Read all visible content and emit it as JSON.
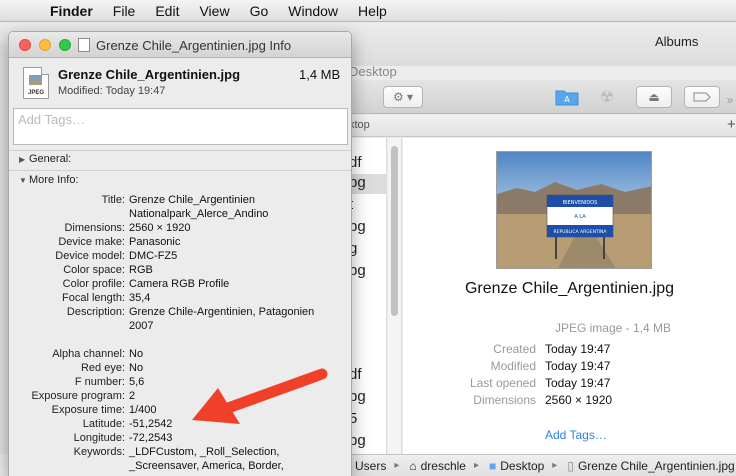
{
  "menubar": {
    "apple": "",
    "items": [
      "Finder",
      "File",
      "Edit",
      "View",
      "Go",
      "Window",
      "Help"
    ]
  },
  "finder": {
    "right_title": "Albums",
    "window_title": "Desktop",
    "path_header": "ktop",
    "list_fragments": [
      "df",
      "pg",
      "t",
      "pg",
      "g",
      "pg",
      "df",
      "pg",
      "5",
      "pg"
    ],
    "preview": {
      "file_name": "Grenze Chile_Argentinien.jpg",
      "kind_size": "JPEG image - 1,4 MB",
      "rows": [
        {
          "k": "Created",
          "v": "Today 19:47"
        },
        {
          "k": "Modified",
          "v": "Today 19:47"
        },
        {
          "k": "Last opened",
          "v": "Today 19:47"
        },
        {
          "k": "Dimensions",
          "v": "2560 × 1920"
        }
      ],
      "add_tags": "Add Tags…",
      "sign_lines": [
        "BIENVENIDOS",
        "A LA",
        "REPUBLICA ARGENTINA"
      ]
    },
    "pathbar": [
      "Users",
      "dreschle",
      "Desktop",
      "Grenze Chile_Argentinien.jpg"
    ]
  },
  "info": {
    "title": "Grenze Chile_Argentinien.jpg Info",
    "file_icon_label": "JPEG",
    "file_name": "Grenze Chile_Argentinien.jpg",
    "size": "1,4 MB",
    "modified": "Modified: Today 19:47",
    "tags_placeholder": "Add Tags…",
    "general_label": "General:",
    "more_info_label": "More Info:",
    "more_info": [
      {
        "k": "Title:",
        "v": "Grenze Chile_Argentinien"
      },
      {
        "k": "",
        "v": "Nationalpark_Alerce_Andino"
      },
      {
        "k": "Dimensions:",
        "v": "2560 × 1920"
      },
      {
        "k": "Device make:",
        "v": "Panasonic"
      },
      {
        "k": "Device model:",
        "v": "DMC-FZ5"
      },
      {
        "k": "Color space:",
        "v": "RGB"
      },
      {
        "k": "Color profile:",
        "v": "Camera RGB Profile"
      },
      {
        "k": "Focal length:",
        "v": "35,4"
      },
      {
        "k": "Description:",
        "v": "Grenze Chile-Argentinien, Patagonien"
      },
      {
        "k": "",
        "v": "2007"
      },
      {
        "k": "Alpha channel:",
        "v": "No"
      },
      {
        "k": "Red eye:",
        "v": "No"
      },
      {
        "k": "F number:",
        "v": "5,6"
      },
      {
        "k": "Exposure program:",
        "v": "2"
      },
      {
        "k": "Exposure time:",
        "v": "1/400"
      },
      {
        "k": "Latitude:",
        "v": "-51,2542"
      },
      {
        "k": "Longitude:",
        "v": "-72,2543"
      },
      {
        "k": "Keywords:",
        "v": "_LDFCustom, _Roll_Selection,"
      },
      {
        "k": "",
        "v": "_Screensaver, America, Border,"
      }
    ]
  },
  "annotation": {
    "arrow_color": "#f0402a"
  },
  "colors": {
    "link": "#2f7fe0",
    "folder": "#3c8fe0"
  }
}
